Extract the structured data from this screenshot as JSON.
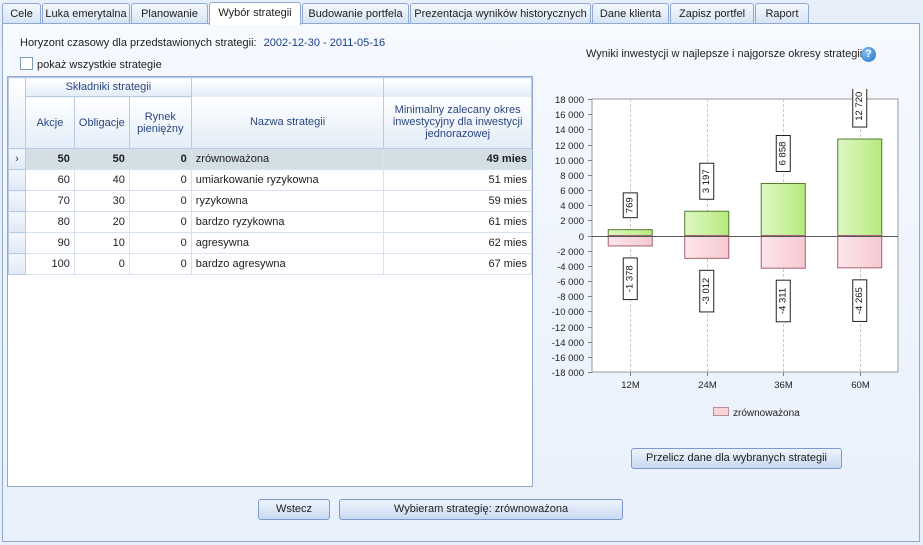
{
  "tabs": [
    {
      "label": "Cele",
      "active": false
    },
    {
      "label": "Luka emerytalna",
      "active": false
    },
    {
      "label": "Planowanie",
      "active": false
    },
    {
      "label": "Wybór strategii",
      "active": true
    },
    {
      "label": "Budowanie portfela",
      "active": false
    },
    {
      "label": "Prezentacja wyników historycznych",
      "active": false
    },
    {
      "label": "Dane klienta",
      "active": false
    },
    {
      "label": "Zapisz portfel",
      "active": false
    },
    {
      "label": "Raport",
      "active": false
    }
  ],
  "horizon": {
    "label": "Horyzont czasowy dla przedstawionych strategii:",
    "value": "2002-12-30 - 2011-05-16"
  },
  "show_all_label": "pokaż wszystkie strategie",
  "grid": {
    "group_header": "Składniki strategii",
    "columns": [
      "Akcje",
      "Obligacje",
      "Rynek pieniężny",
      "Nazwa strategii",
      "Minimalny zalecany okres inwestycyjny dla inwestycji jednorazowej"
    ],
    "selected_index": 0,
    "rows": [
      {
        "akcje": "50",
        "obligacje": "50",
        "rynek": "0",
        "nazwa": "zrównoważona",
        "okres": "49 mies"
      },
      {
        "akcje": "60",
        "obligacje": "40",
        "rynek": "0",
        "nazwa": "umiarkowanie ryzykowna",
        "okres": "51 mies"
      },
      {
        "akcje": "70",
        "obligacje": "30",
        "rynek": "0",
        "nazwa": "ryzykowna",
        "okres": "59 mies"
      },
      {
        "akcje": "80",
        "obligacje": "20",
        "rynek": "0",
        "nazwa": "bardzo ryzykowna",
        "okres": "61 mies"
      },
      {
        "akcje": "90",
        "obligacje": "10",
        "rynek": "0",
        "nazwa": "agresywna",
        "okres": "62 mies"
      },
      {
        "akcje": "100",
        "obligacje": "0",
        "rynek": "0",
        "nazwa": "bardzo agresywna",
        "okres": "67 mies"
      }
    ]
  },
  "chart_title": "Wyniki inwestycji w najlepsze i najgorsze okresy strategii",
  "help_icon": "question-mark-icon",
  "chart_data": {
    "type": "bar",
    "title": "Wyniki inwestycji w najlepsze i najgorsze okresy strategii",
    "categories": [
      "12M",
      "24M",
      "36M",
      "60M"
    ],
    "series": [
      {
        "name": "zrównoważona",
        "kind": "best",
        "values": [
          769,
          3197,
          6858,
          12720
        ],
        "labels": [
          "769",
          "3 197",
          "6 858",
          "12 720"
        ],
        "color": "#c8f0a0"
      },
      {
        "name": "zrównoważona",
        "kind": "worst",
        "values": [
          -1378,
          -3012,
          -4311,
          -4265
        ],
        "labels": [
          "-1 378",
          "-3 012",
          "-4 311",
          "-4 265"
        ],
        "color": "#f7d2d8"
      }
    ],
    "ylim": [
      -18000,
      18000
    ],
    "yticks": [
      18000,
      16000,
      14000,
      12000,
      10000,
      8000,
      6000,
      4000,
      2000,
      0,
      -2000,
      -4000,
      -6000,
      -8000,
      -10000,
      -12000,
      -14000,
      -16000,
      -18000
    ],
    "ytick_labels": [
      "18 000",
      "16 000",
      "14 000",
      "12 000",
      "10 000",
      "8 000",
      "6 000",
      "4 000",
      "2 000",
      "0",
      "-2 000",
      "-4 000",
      "-6 000",
      "-8 000",
      "-10 000",
      "-12 000",
      "-14 000",
      "-16 000",
      "-18 000"
    ],
    "legend": "zrównoważona",
    "legend_position": "bottom",
    "grid": true
  },
  "buttons": {
    "recalc": "Przelicz dane dla wybranych strategii",
    "back": "Wstecz",
    "choose": "Wybieram strategię: zrównoważona"
  }
}
